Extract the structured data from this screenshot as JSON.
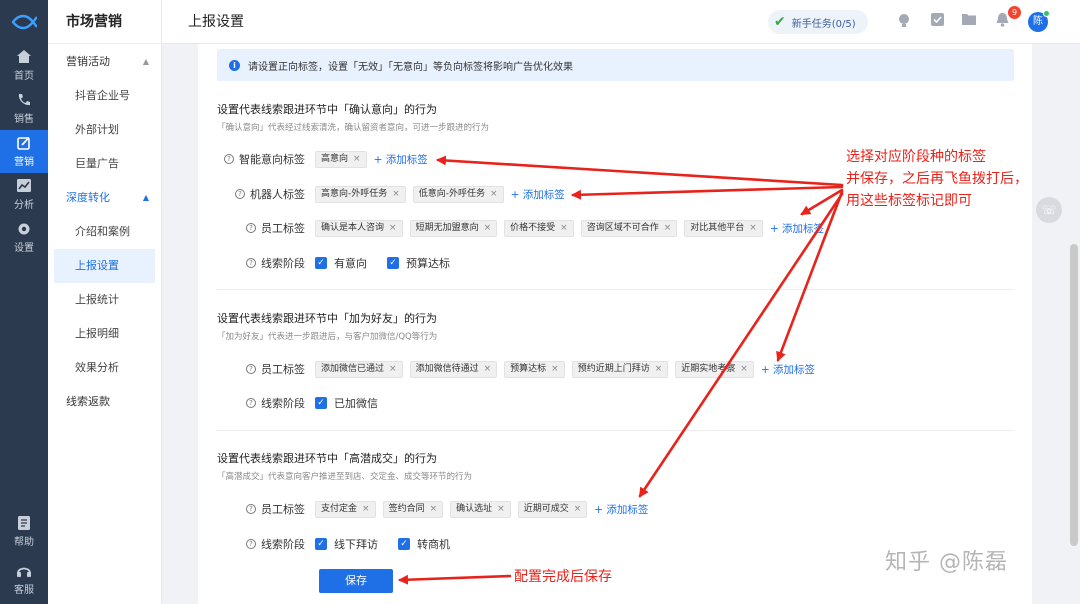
{
  "rail": {
    "items": [
      {
        "label": "首页",
        "icon": "home-icon"
      },
      {
        "label": "销售",
        "icon": "phone-icon"
      },
      {
        "label": "营销",
        "icon": "edit-icon"
      },
      {
        "label": "分析",
        "icon": "chart-icon"
      },
      {
        "label": "设置",
        "icon": "gear-icon"
      }
    ],
    "bottom": [
      {
        "label": "帮助",
        "icon": "help-icon"
      },
      {
        "label": "客服",
        "icon": "headset-icon"
      }
    ]
  },
  "sidebar": {
    "title": "市场营销",
    "groups": [
      {
        "label": "营销活动",
        "caret": "▲"
      },
      {
        "label": "深度转化",
        "caret": "▲"
      },
      {
        "label": "线索返款"
      }
    ],
    "items": [
      "抖音企业号",
      "外部计划",
      "巨量广告",
      "介绍和案例",
      "上报设置",
      "上报统计",
      "上报明细",
      "效果分析"
    ]
  },
  "header": {
    "title": "上报设置",
    "task_label": "新手任务(0/5)",
    "bell_count": "9",
    "avatar": "陈"
  },
  "notice": "请设置正向标签，设置「无效」「无意向」等负向标签将影响广告优化效果",
  "sections": [
    {
      "title": "设置代表线索跟进环节中「确认意向」的行为",
      "desc": "「确认意向」代表经过线索清洗，确认留资者意向，可进一步跟进的行为",
      "rows": [
        {
          "label": "智能意向标签",
          "tags": [
            "高意向"
          ],
          "add": "+ 添加标签"
        },
        {
          "label": "机器人标签",
          "tags": [
            "高意向-外呼任务",
            "低意向-外呼任务"
          ],
          "add": "+ 添加标签"
        },
        {
          "label": "员工标签",
          "tags": [
            "确认是本人咨询",
            "短期无加盟意向",
            "价格不接受",
            "咨询区域不可合作",
            "对比其他平台"
          ],
          "add": "+ 添加标签"
        },
        {
          "label": "线索阶段",
          "checks": [
            "有意向",
            "预算达标"
          ]
        }
      ]
    },
    {
      "title": "设置代表线索跟进环节中「加为好友」的行为",
      "desc": "「加为好友」代表进一步跟进后，与客户加微信/QQ等行为",
      "rows": [
        {
          "label": "员工标签",
          "tags": [
            "添加微信已通过",
            "添加微信待通过",
            "预算达标",
            "预约近期上门拜访",
            "近期实地考察"
          ],
          "add": "+ 添加标签"
        },
        {
          "label": "线索阶段",
          "checks": [
            "已加微信"
          ]
        }
      ]
    },
    {
      "title": "设置代表线索跟进环节中「高潜成交」的行为",
      "desc": "「高潜成交」代表意向客户推进至到店、交定金、成交等环节的行为",
      "rows": [
        {
          "label": "员工标签",
          "tags": [
            "支付定金",
            "签约合同",
            "确认选址",
            "近期可成交"
          ],
          "add": "+ 添加标签"
        },
        {
          "label": "线索阶段",
          "checks": [
            "线下拜访",
            "转商机"
          ]
        }
      ]
    }
  ],
  "save_label": "保存",
  "annotations": {
    "main": [
      "选择对应阶段种的标签",
      "并保存，之后再飞鱼拨打后，",
      "用这些标签标记即可"
    ],
    "save": "配置完成后保存"
  },
  "watermark": "知乎 @陈磊",
  "colors": {
    "accent": "#1f6fe6",
    "rail_bg": "#2b3a4e",
    "annotation": "#e8231b"
  }
}
